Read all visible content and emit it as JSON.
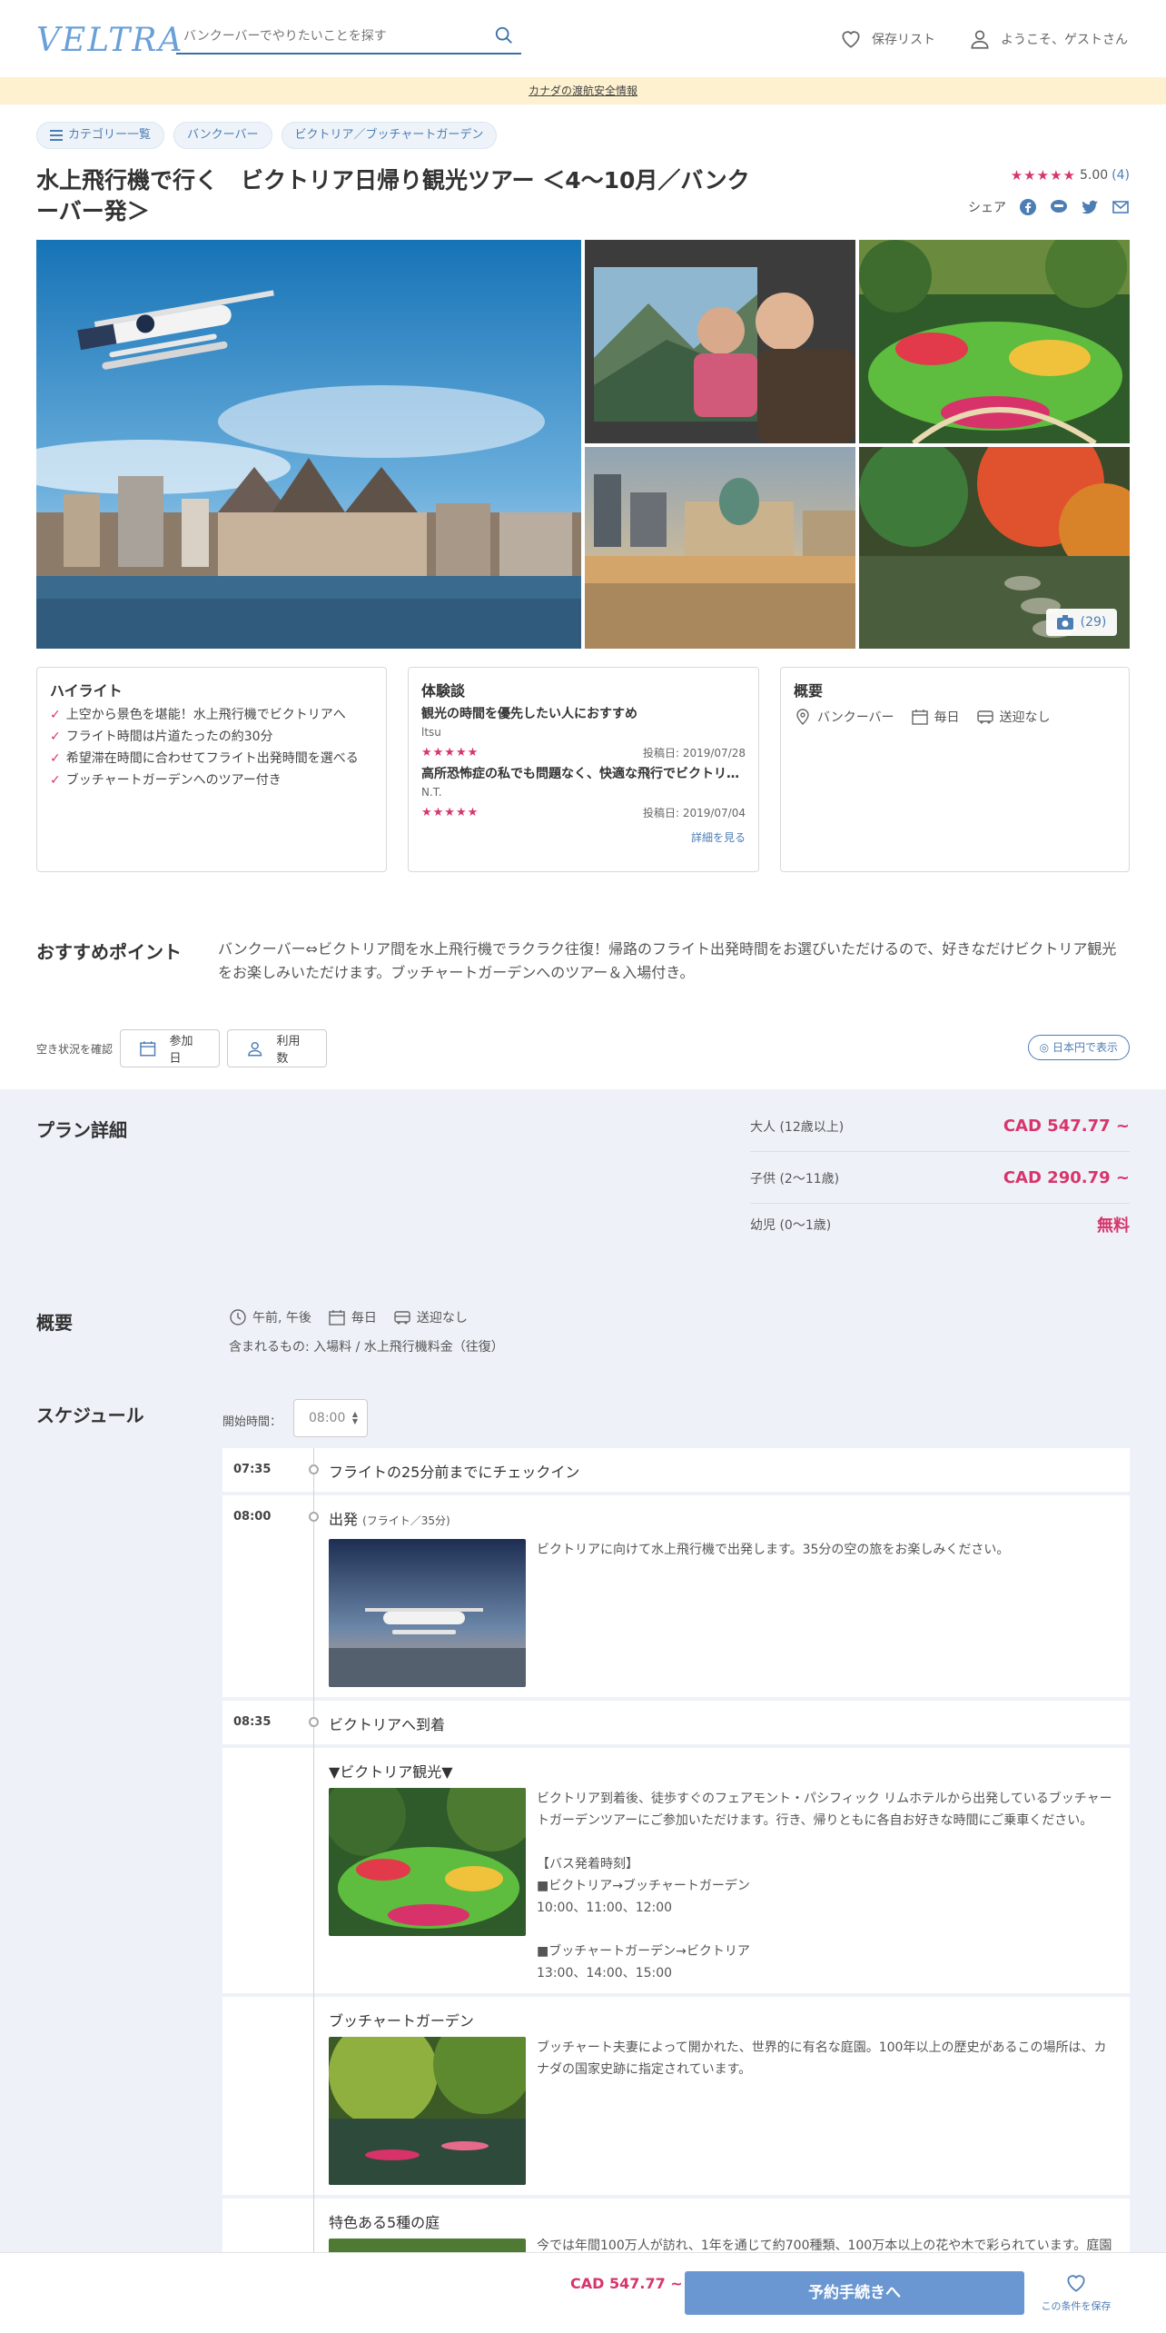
{
  "header": {
    "logo": "VELTRA",
    "search_placeholder": "バンクーバーでやりたいことを探す",
    "wishlist_label": "保存リスト",
    "account_label": "ようこそ、ゲストさん"
  },
  "safety_notice": "カナダの渡航安全情報",
  "breadcrumbs": [
    "カテゴリー一覧",
    "バンクーバー",
    "ビクトリア／ブッチャートガーデン"
  ],
  "tour": {
    "title": "水上飛行機で行く　ビクトリア日帰り観光ツアー ＜4～10月／バンクーバー発＞",
    "rating_stars": "★★★★★",
    "rating_value": "5.00",
    "review_count": "(4)",
    "share_label": "シェア",
    "photo_count": "(29)"
  },
  "highlights": {
    "title": "ハイライト",
    "items": [
      "上空から景色を堪能！水上飛行機でビクトリアへ",
      "フライト時間は片道たったの約30分",
      "希望滞在時間に合わせてフライト出発時間を選べる",
      "ブッチャートガーデンへのツアー付き"
    ]
  },
  "reviews": {
    "title": "体験談",
    "items": [
      {
        "title": "観光の時間を優先したい人におすすめ",
        "author": "ltsu",
        "stars": "★★★★★",
        "date": "投稿日: 2019/07/28"
      },
      {
        "title": "高所恐怖症の私でも問題なく、快適な飛行でビクトリアへ",
        "author": "N.T.",
        "stars": "★★★★★",
        "date": "投稿日: 2019/07/04"
      }
    ],
    "more_label": "詳細を見る"
  },
  "overview_card": {
    "title": "概要",
    "location": "バンクーバー",
    "frequency": "毎日",
    "pickup": "送迎なし"
  },
  "recommend": {
    "heading": "おすすめポイント",
    "text": "バンクーバー⇔ビクトリア間を水上飛行機でラクラク往復！帰路のフライト出発時間をお選びいただけるので、好きなだけビクトリア観光をお楽しみいただけます。ブッチャートガーデンへのツアー＆入場付き。"
  },
  "availability": {
    "label": "空き状況を確認",
    "date_button": "参加日",
    "people_button": "利用数",
    "yen_toggle": "日本円で表示"
  },
  "plan": {
    "heading": "プラン詳細",
    "prices": [
      {
        "label": "大人 (12歳以上)",
        "value": "CAD 547.77 ~"
      },
      {
        "label": "子供 (2～11歳)",
        "value": "CAD 290.79 ~"
      },
      {
        "label": "幼児 (0～1歳)",
        "value": "無料"
      }
    ]
  },
  "overview": {
    "heading": "概要",
    "time": "午前, 午後",
    "frequency": "毎日",
    "pickup": "送迎なし",
    "includes": "含まれるもの: 入場料 / 水上飛行機料金（往復）"
  },
  "schedule": {
    "heading": "スケジュール",
    "start_label": "開始時間：",
    "start_value": "08:00",
    "rows": [
      {
        "time": "07:35",
        "title": "フライトの25分前までにチェックイン"
      },
      {
        "time": "08:00",
        "title": "出発",
        "subtitle": "(フライト／35分)",
        "desc": "ビクトリアに向けて水上飛行機で出発します。35分の空の旅をお楽しみください。"
      },
      {
        "time": "08:35",
        "title": "ビクトリアへ到着"
      },
      {
        "title": "▼ビクトリア観光▼",
        "desc_lines": [
          "ビクトリア到着後、徒歩すぐのフェアモント・パシフィック リムホテルから出発しているブッチャートガーデンツアーにご参加いただけます。行き、帰りともに各自お好きな時間にご乗車ください。",
          "",
          "【バス発着時刻】",
          "■ビクトリア→ブッチャートガーデン",
          "10:00、11:00、12:00",
          "",
          "■ブッチャートガーデン→ビクトリア",
          "13:00、14:00、15:00"
        ]
      },
      {
        "title": "ブッチャートガーデン",
        "desc": "ブッチャート夫妻によって開かれた、世界的に有名な庭園。100年以上の歴史があるこの場所は、カナダの国家史跡に指定されています。"
      },
      {
        "title": "特色ある5種の庭",
        "desc": "今では年間100万人が訪れ、1年を通じて約700種類、100万本以上の花や木で彩られています。庭園"
      }
    ]
  },
  "bottom_bar": {
    "price": "CAD 547.77 ~",
    "book_label": "予約手続きへ",
    "save_label": "この条件を保存"
  },
  "colors": {
    "accent_pink": "#d7356b",
    "brand_blue": "#4d7db5",
    "button_blue": "#6a97d1",
    "notice_yellow": "#fdf1cf",
    "plan_bg": "#eef2f8"
  }
}
